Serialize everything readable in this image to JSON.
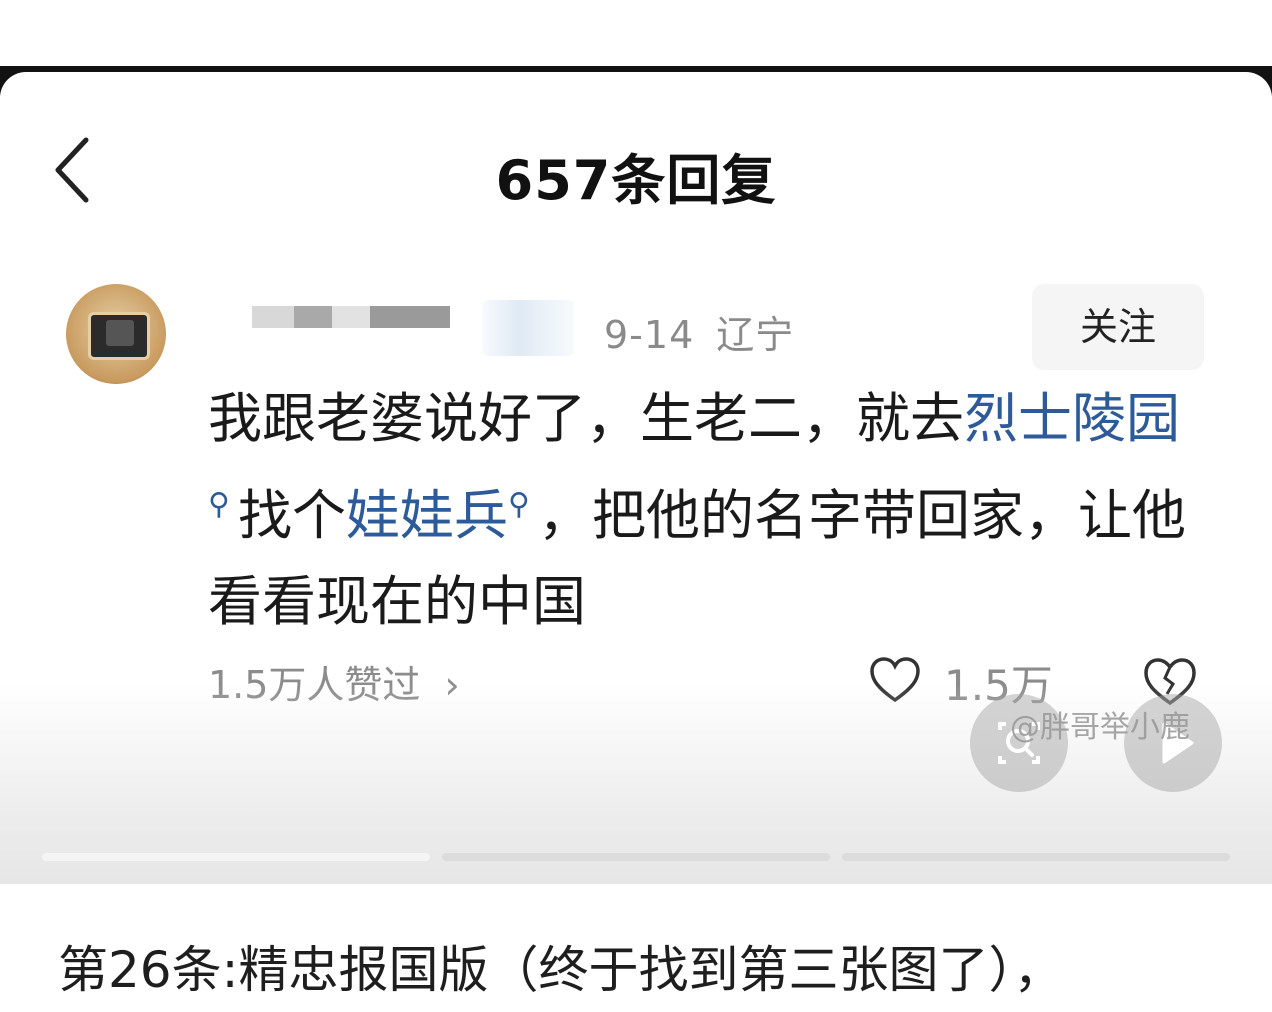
{
  "header": {
    "title": "657条回复",
    "back_icon": "chevron-left-icon"
  },
  "comment": {
    "date": "9-14",
    "location": "辽宁",
    "follow_label": "关注",
    "text_part1": "我跟老婆说好了，生老二，就去",
    "link1": "烈士陵园",
    "text_part2": "找个",
    "link2": "娃娃兵",
    "text_part3": "，把他的名字带回家，让他看看现在的中国",
    "likers_text": "1.5万人赞过",
    "like_count": "1.5万"
  },
  "overlay": {
    "watermark": "@胖哥举小鹿"
  },
  "caption": {
    "text": "第26条:精忠报国版（终于找到第三张图了），"
  },
  "colors": {
    "link": "#2d5b9a",
    "meta_gray": "#8a8a8a",
    "dark_band": "#121212"
  }
}
